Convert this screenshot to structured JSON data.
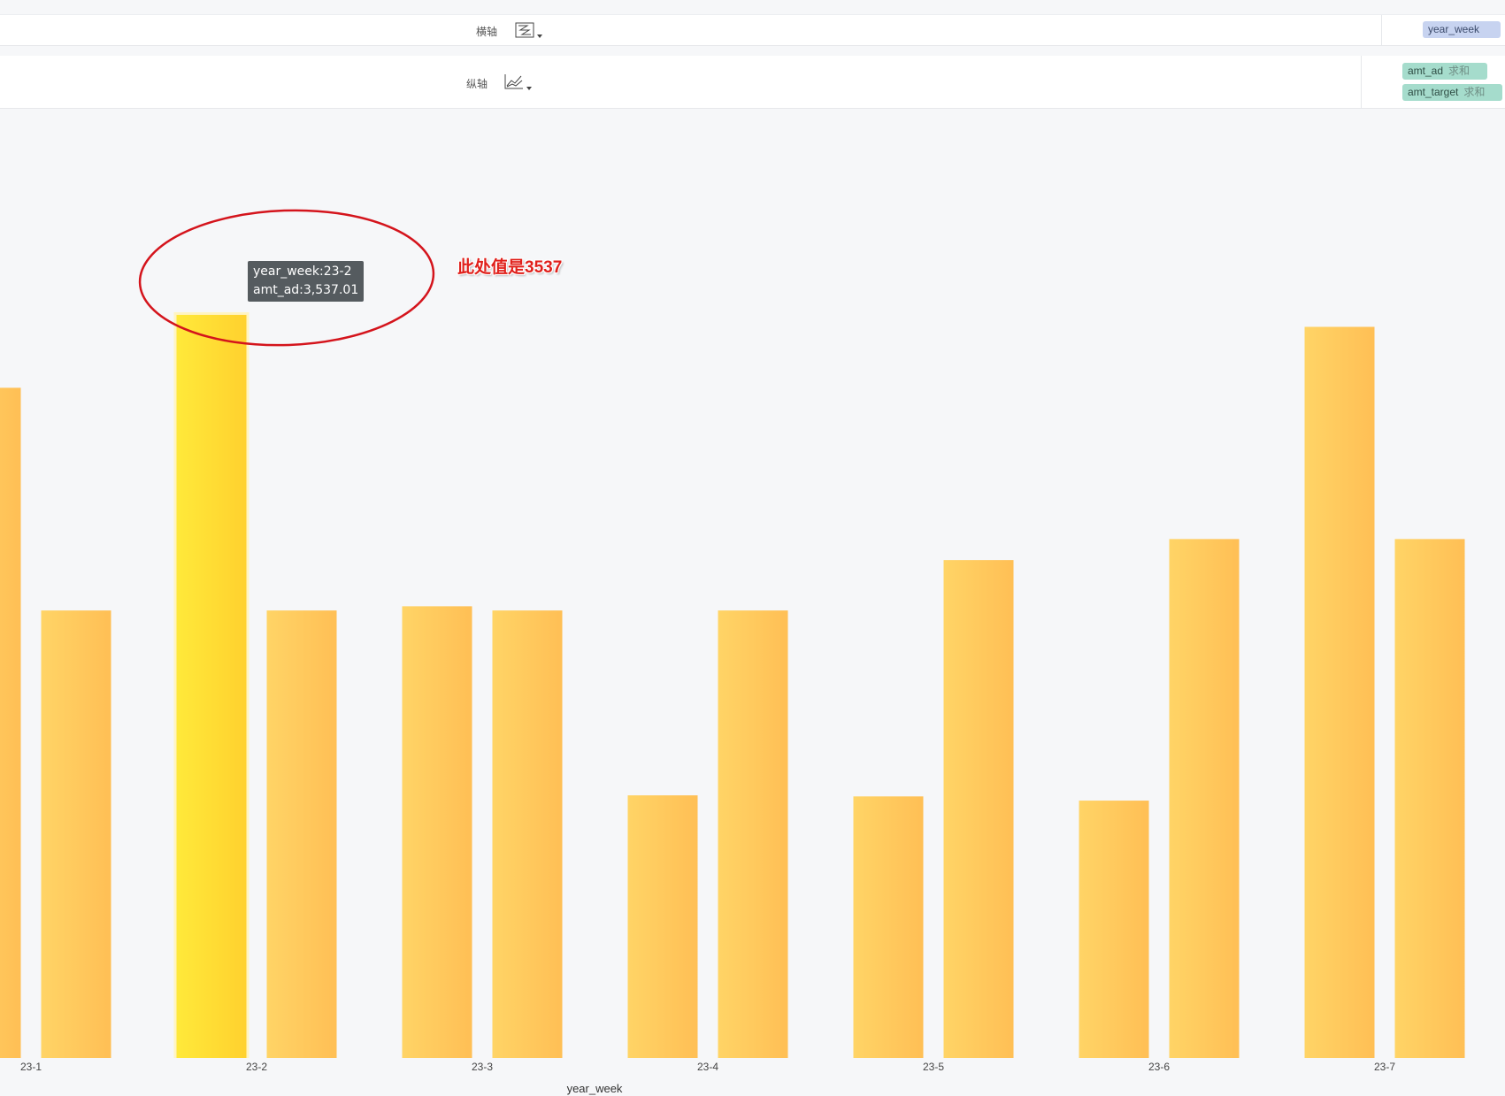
{
  "shelves": {
    "x_label": "横轴",
    "x_field": "year_week",
    "y_label": "纵轴",
    "y_fields": [
      {
        "name": "amt_ad",
        "agg": "求和"
      },
      {
        "name": "amt_target",
        "agg": "求和"
      }
    ]
  },
  "colors": {
    "bar_start": "#ffd466",
    "bar_end": "#ffbf55",
    "bar_highlight_start": "#ffe93a",
    "bar_highlight_end": "#ffd12e",
    "annotation": "#e0201b"
  },
  "tooltip": {
    "line1": "year_week:23-2",
    "line2": "amt_ad:3,537.01"
  },
  "annotation": {
    "text": "此处值是3537"
  },
  "chart_data": {
    "type": "bar",
    "xlabel": "year_week",
    "categories": [
      "23-1",
      "23-2",
      "23-3",
      "23-4",
      "23-5",
      "23-6",
      "23-7"
    ],
    "series": [
      {
        "name": "amt_ad",
        "values": [
          3190,
          3537.01,
          2150,
          1250,
          1245,
          1225,
          3480
        ]
      },
      {
        "name": "amt_target",
        "values": [
          2130,
          2130,
          2130,
          2130,
          2370,
          2470,
          2470
        ]
      }
    ],
    "ylim": [
      0,
      4000
    ],
    "highlight": {
      "series": "amt_ad",
      "category": "23-2"
    },
    "grid": false,
    "legend": "none"
  }
}
